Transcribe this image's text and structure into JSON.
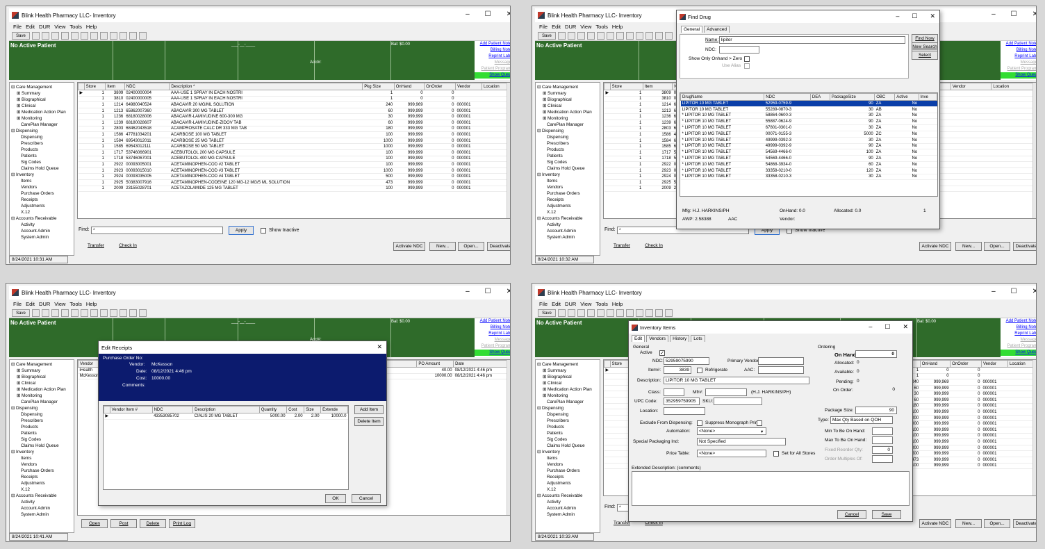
{
  "app": {
    "title": "Blink Health Pharmacy LLC- Inventory",
    "menu": [
      "File",
      "Edit",
      "DUR",
      "View",
      "Tools",
      "Help"
    ],
    "save_label": "Save",
    "no_patient": "No Active Patient",
    "dash": "___-__-____",
    "acct": "Acct#:",
    "balance": "Bal: $0.00",
    "links": [
      "Add Patient Notes",
      "Billing Notes",
      "Reprint Label",
      "Messages",
      "Patient Programs",
      "Show Queue"
    ]
  },
  "tree": [
    {
      "t": "Care Management",
      "l": 0
    },
    {
      "t": "Summary",
      "l": 1
    },
    {
      "t": "Biographical",
      "l": 1
    },
    {
      "t": "Clinical",
      "l": 1
    },
    {
      "t": "Medication Action Plan",
      "l": 1
    },
    {
      "t": "Monitoring",
      "l": 1
    },
    {
      "t": "CarePlan Manager",
      "l": 2
    },
    {
      "t": "Dispensing",
      "l": 0
    },
    {
      "t": "Dispensing",
      "l": 2
    },
    {
      "t": "Prescribers",
      "l": 2
    },
    {
      "t": "Products",
      "l": 2
    },
    {
      "t": "Patients",
      "l": 2
    },
    {
      "t": "Sig Codes",
      "l": 2
    },
    {
      "t": "Claims Hold Queue",
      "l": 2
    },
    {
      "t": "Inventory",
      "l": 0
    },
    {
      "t": "Items",
      "l": 2
    },
    {
      "t": "Vendors",
      "l": 2
    },
    {
      "t": "Purchase Orders",
      "l": 2
    },
    {
      "t": "Receipts",
      "l": 2
    },
    {
      "t": "Adjustments",
      "l": 2
    },
    {
      "t": "X.12",
      "l": 2
    },
    {
      "t": "Accounts Receivable",
      "l": 0
    },
    {
      "t": "Activity",
      "l": 2
    },
    {
      "t": "Account Admin",
      "l": 2
    },
    {
      "t": "System Admin",
      "l": 2
    }
  ],
  "inventory": {
    "headers": [
      "Store",
      "Item",
      "NDC",
      "Description *",
      "Pkg Size",
      "OnHand",
      "OnOrder",
      "Vendor",
      "Location"
    ],
    "rows": [
      [
        "1",
        "3809",
        "02400000004",
        "AAA-USE 1 SPRAY IN EACH NOSTRI",
        "1",
        "0",
        "0",
        ""
      ],
      [
        "1",
        "3810",
        "02400000005",
        "AAA-USE 1 SPRAY IN EACH NOSTRI",
        "1",
        "0",
        "0",
        ""
      ],
      [
        "1",
        "1214",
        "64980040524",
        "ABACAVIR 20 MG/ML SOLUTION",
        "240",
        "999,969",
        "0",
        "000001"
      ],
      [
        "1",
        "1213",
        "65862007360",
        "ABACAVIR 300 MG TABLET",
        "60",
        "999,999",
        "0",
        "000001"
      ],
      [
        "1",
        "1236",
        "68180028006",
        "ABACAVIR-LAMIVUDINE 600-300 MG",
        "30",
        "999,999",
        "0",
        "000001"
      ],
      [
        "1",
        "1239",
        "68180028607",
        "ABACAVIR-LAMIVUDINE-ZIDOV TAB",
        "60",
        "999,999",
        "0",
        "000001"
      ],
      [
        "1",
        "2803",
        "68462043518",
        "ACAMPROSATE CALC DR 333 MG TAB",
        "180",
        "999,999",
        "0",
        "000001"
      ],
      [
        "1",
        "1586",
        "47781034201",
        "ACARBOSE 100 MG TABLET",
        "100",
        "999,999",
        "0",
        "000001"
      ],
      [
        "1",
        "1584",
        "69543012011",
        "ACARBOSE 25 MG TABLET",
        "1000",
        "999,999",
        "0",
        "000001"
      ],
      [
        "1",
        "1585",
        "69543012111",
        "ACARBOSE 50 MG TABLET",
        "1000",
        "999,999",
        "0",
        "000001"
      ],
      [
        "1",
        "1717",
        "53746066901",
        "ACEBUTOLOL 200 MG CAPSULE",
        "100",
        "999,999",
        "0",
        "000001"
      ],
      [
        "1",
        "1718",
        "53746067001",
        "ACEBUTOLOL 400 MG CAPSULE",
        "100",
        "999,999",
        "0",
        "000001"
      ],
      [
        "1",
        "2922",
        "00093005001",
        "ACETAMINOPHEN-COD #2 TABLET",
        "100",
        "999,999",
        "0",
        "000001"
      ],
      [
        "1",
        "2923",
        "00093015010",
        "ACETAMINOPHEN-COD #3 TABLET",
        "1000",
        "999,999",
        "0",
        "000001"
      ],
      [
        "1",
        "2924",
        "00093035005",
        "ACETAMINOPHEN-COD #4 TABLET",
        "500",
        "999,999",
        "0",
        "000001"
      ],
      [
        "1",
        "2925",
        "50383007916",
        "ACETAMINOPHEN-CODEINE 120 MG-12 MG/5 ML SOLUTION",
        "473",
        "999,999",
        "0",
        "000001"
      ],
      [
        "1",
        "2009",
        "23155028701",
        "ACETAZOLAMIDE 125 MG TABLET",
        "100",
        "999,999",
        "0",
        "000001"
      ]
    ],
    "find_label": "Find:",
    "find_value": "*",
    "apply": "Apply",
    "show_inactive": "Show Inactive",
    "buttons_left": [
      "Transfer",
      "Check In"
    ],
    "buttons_right": [
      "Activate NDC",
      "New...",
      "Open...",
      "Deactivate"
    ]
  },
  "panels": [
    {
      "timestamp": "8/24/2021 10:31 AM"
    },
    {
      "timestamp": "8/24/2021 10:32 AM"
    },
    {
      "timestamp": "8/24/2021 10:41 AM"
    },
    {
      "timestamp": "8/24/2021 10:33 AM"
    }
  ],
  "find_drug": {
    "title": "Find Drug",
    "tabs": [
      "General",
      "Advanced"
    ],
    "name_label": "Name:",
    "name_value": "lipitor",
    "ndc_label": "NDC:",
    "onhand_label": "Show Only Onhand > Zero",
    "alias_label": "Use Alias",
    "buttons": [
      "Find Now",
      "New Search",
      "Select"
    ],
    "headers": [
      "DrugName",
      "NDC",
      "DEA",
      "PackageSize",
      "OBC",
      "Active",
      "Inve"
    ],
    "rows": [
      [
        "LIPITOR 10 MG TABLET",
        "52959-0759-9",
        "",
        "90",
        "ZA",
        "No"
      ],
      [
        "LIPITOR 10 MG TABLET",
        "55289-0870-3",
        "",
        "30",
        "AB",
        "No"
      ],
      [
        "* LIPITOR 10 MG TABLET",
        "58864-0600-3",
        "",
        "30",
        "ZA",
        "No"
      ],
      [
        "* LIPITOR 10 MG TABLET",
        "55887-0624-9",
        "",
        "90",
        "ZA",
        "No"
      ],
      [
        "* LIPITOR 10 MG TABLET",
        "67801-0301-0",
        "",
        "30",
        "ZA",
        "No"
      ],
      [
        "* LIPITOR 10 MG TABLET",
        "00071-0155-3",
        "",
        "5000",
        "ZC",
        "No"
      ],
      [
        "* LIPITOR 10 MG TABLET",
        "49999-0392-3",
        "",
        "30",
        "ZA",
        "No"
      ],
      [
        "* LIPITOR 10 MG TABLET",
        "49999-0392-9",
        "",
        "90",
        "ZA",
        "No"
      ],
      [
        "* LIPITOR 10 MG TABLET",
        "54569-4466-0",
        "",
        "100",
        "ZA",
        "No"
      ],
      [
        "* LIPITOR 10 MG TABLET",
        "54569-4466-0",
        "",
        "90",
        "ZA",
        "No"
      ],
      [
        "* LIPITOR 10 MG TABLET",
        "54868-3934-0",
        "",
        "60",
        "ZA",
        "No"
      ],
      [
        "* LIPITOR 10 MG TABLET",
        "33358-0210-0",
        "",
        "120",
        "ZA",
        "No"
      ],
      [
        "* LIPITOR 10 MG TABLET",
        "33358-0210-3",
        "",
        "30",
        "ZA",
        "No"
      ]
    ],
    "mfg": "Mfg: H.J. HARKINS/PH",
    "onhand": "OnHand: 0.0",
    "allocated": "Allocated: 0.0",
    "count": "1",
    "awp": "AWP: 2.58388",
    "aac": "AAC",
    "vendor": "Vendor:"
  },
  "edit_receipts": {
    "title": "Edit Receipts",
    "po_label": "Purchase Order No:",
    "vendor_label": "Vendor:",
    "vendor": "McKesson",
    "date_label": "Date:",
    "date": "08/12/2021 4:46 pm",
    "cost_label": "Cost:",
    "cost": "10000.00",
    "comments_label": "Comments:",
    "headers": [
      "Vendor Item #",
      "NDC",
      "Description",
      "Quantity",
      "Cost",
      "Size",
      "Extende"
    ],
    "row": [
      "",
      "43353085702",
      "CIALIS 20 MG TABLET",
      "5000.00",
      "2.00",
      "2.00",
      "10000.0"
    ],
    "add_item": "Add Item",
    "delete_item": "Delete Item",
    "ok": "OK",
    "cancel": "Cancel",
    "bg_headers": [
      "Vendor",
      "PO Amount",
      "Date"
    ],
    "bg_rows": [
      [
        "iHealth",
        "40.00",
        "08/12/2021 4:46 pm"
      ],
      [
        "McKesson",
        "10000.00",
        "08/12/2021 4:46 pm"
      ]
    ],
    "bottom_buttons": [
      "Open",
      "Post",
      "Delete",
      "Print Log"
    ]
  },
  "inventory_items": {
    "title": "Inventory Items",
    "tabs": [
      "Edit",
      "Vendors",
      "History",
      "Lots"
    ],
    "general": "General",
    "active": "Active",
    "ndc_label": "NDC:",
    "ndc": "52959075990",
    "primary_vendor": "Primary Vendor:",
    "item_label": "Item#:",
    "item": "3839",
    "refrigerate": "Refrigerate",
    "aac": "AAC:",
    "desc_label": "Description:",
    "desc": "LIPITOR 10 MG TABLET",
    "class_label": "Class:",
    "mfr_label": "Mfr#:",
    "mfr": "(H.J. HARKINS/PH)",
    "upc_label": "UPC Code:",
    "upc": "352959759905",
    "sku_label": "SKU:",
    "location_label": "Location:",
    "exclude": "Exclude From Dispensing:",
    "suppress": "Suppress Monograph Print",
    "automation_label": "Automation:",
    "automation": "<None>",
    "special_label": "Special Packaging Ind:",
    "special": "Not Specified",
    "price_label": "Price Table:",
    "price": "<None>",
    "set_all": "Set for All Stores",
    "ordering": "Ordering",
    "on_hand_label": "On Hand:",
    "on_hand": "0",
    "allocated_label": "Allocated:",
    "allocated": "0",
    "available_label": "Available:",
    "available": "0",
    "pending_label": "Pending:",
    "pending": "0",
    "on_order_label": "On Order:",
    "on_order": "0",
    "pkg_label": "Package Size:",
    "pkg": "90",
    "type_label": "Type:",
    "type": "Max Qty Based on QOH",
    "min_label": "Min To Be On Hand:",
    "max_label": "Max To Be On Hand:",
    "fixed_label": "Fixed Reorder Qty:",
    "fixed": "0",
    "multiples_label": "Order Multiples Of:",
    "ext_label": "Extended Description: (comments)",
    "cancel": "Cancel",
    "save": "Save"
  }
}
